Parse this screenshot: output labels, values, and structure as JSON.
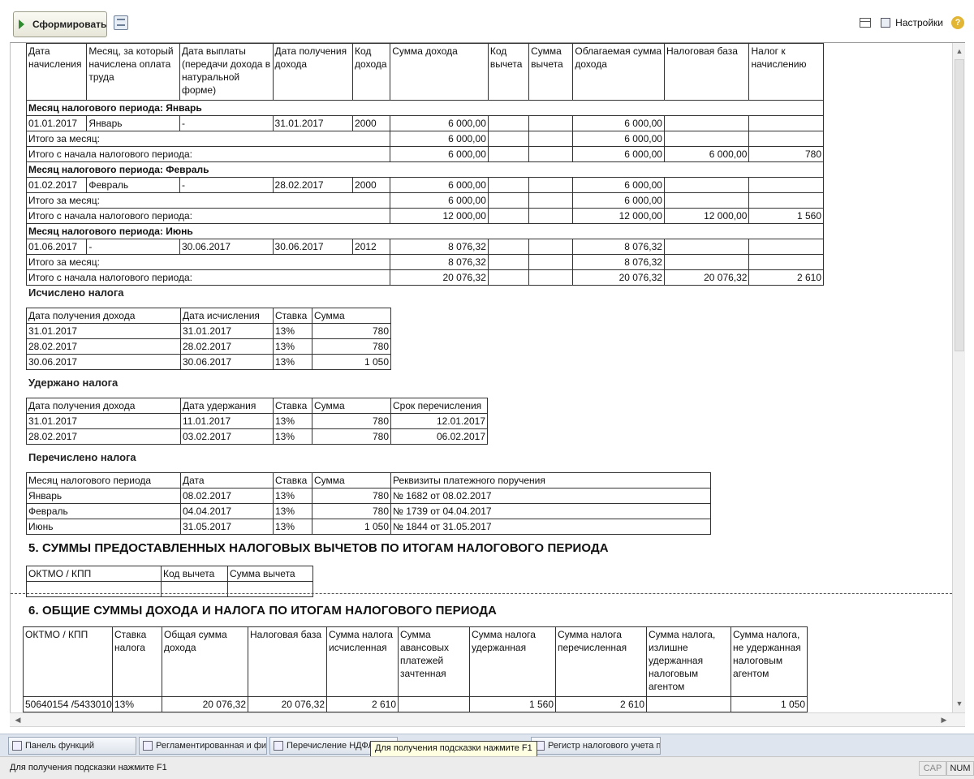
{
  "toolbar": {
    "form_button": "Сформировать",
    "settings_label": "Настройки",
    "help": "?"
  },
  "table1": {
    "headers": [
      "Дата начисления",
      "Месяц, за который начислена оплата труда",
      "Дата выплаты (передачи дохода в натуральной форме)",
      "Дата получения дохода",
      "Код дохода",
      "Сумма дохода",
      "Код вычета",
      "Сумма вычета",
      "Облагаемая сумма дохода",
      "Налоговая база",
      "Налог к начислению"
    ],
    "groups": [
      {
        "title": "Месяц налогового периода: Январь",
        "row": [
          "01.01.2017",
          "Январь",
          "-",
          "31.01.2017",
          "2000",
          "6 000,00",
          "",
          "",
          "6 000,00",
          "",
          ""
        ],
        "month_total": {
          "label": "Итого за месяц:",
          "income": "6 000,00",
          "taxable": "6 000,00"
        },
        "ytd_total": {
          "label": "Итого с начала налогового периода:",
          "income": "6 000,00",
          "taxable": "6 000,00",
          "base": "6 000,00",
          "tax": "780"
        }
      },
      {
        "title": "Месяц налогового периода: Февраль",
        "row": [
          "01.02.2017",
          "Февраль",
          "-",
          "28.02.2017",
          "2000",
          "6 000,00",
          "",
          "",
          "6 000,00",
          "",
          ""
        ],
        "month_total": {
          "label": "Итого за месяц:",
          "income": "6 000,00",
          "taxable": "6 000,00"
        },
        "ytd_total": {
          "label": "Итого с начала налогового периода:",
          "income": "12 000,00",
          "taxable": "12 000,00",
          "base": "12 000,00",
          "tax": "1 560"
        }
      },
      {
        "title": "Месяц налогового периода: Июнь",
        "row": [
          "01.06.2017",
          "-",
          "30.06.2017",
          "30.06.2017",
          "2012",
          "8 076,32",
          "",
          "",
          "8 076,32",
          "",
          ""
        ],
        "month_total": {
          "label": "Итого за месяц:",
          "income": "8 076,32",
          "taxable": "8 076,32"
        },
        "ytd_total": {
          "label": "Итого с начала налогового периода:",
          "income": "20 076,32",
          "taxable": "20 076,32",
          "base": "20 076,32",
          "tax": "2 610"
        }
      }
    ]
  },
  "calc": {
    "title": "Исчислено налога",
    "headers": [
      "Дата получения дохода",
      "Дата исчисления",
      "Ставка",
      "Сумма"
    ],
    "rows": [
      [
        "31.01.2017",
        "31.01.2017",
        "13%",
        "780"
      ],
      [
        "28.02.2017",
        "28.02.2017",
        "13%",
        "780"
      ],
      [
        "30.06.2017",
        "30.06.2017",
        "13%",
        "1 050"
      ]
    ]
  },
  "withheld": {
    "title": "Удержано налога",
    "headers": [
      "Дата получения дохода",
      "Дата удержания",
      "Ставка",
      "Сумма",
      "Срок перечисления"
    ],
    "rows": [
      [
        "31.01.2017",
        "11.01.2017",
        "13%",
        "780",
        "12.01.2017"
      ],
      [
        "28.02.2017",
        "03.02.2017",
        "13%",
        "780",
        "06.02.2017"
      ]
    ]
  },
  "paid": {
    "title": "Перечислено налога",
    "headers": [
      "Месяц налогового периода",
      "Дата",
      "Ставка",
      "Сумма",
      "Реквизиты платежного поручения"
    ],
    "rows": [
      [
        "Январь",
        "08.02.2017",
        "13%",
        "780",
        "№ 1682 от 08.02.2017"
      ],
      [
        "Февраль",
        "04.04.2017",
        "13%",
        "780",
        "№ 1739 от 04.04.2017"
      ],
      [
        "Июнь",
        "31.05.2017",
        "13%",
        "1 050",
        "№ 1844 от 31.05.2017"
      ]
    ]
  },
  "section5": {
    "title": "5. СУММЫ ПРЕДОСТАВЛЕННЫХ НАЛОГОВЫХ ВЫЧЕТОВ ПО ИТОГАМ НАЛОГОВОГО ПЕРИОДА",
    "headers": [
      "ОКТМО / КПП",
      "Код вычета",
      "Сумма вычета"
    ]
  },
  "section6": {
    "title": "6. ОБЩИЕ СУММЫ ДОХОДА И НАЛОГА ПО ИТОГАМ НАЛОГОВОГО ПЕРИОДА",
    "headers": [
      "ОКТМО / КПП",
      "Ставка налога",
      "Общая сумма дохода",
      "Налоговая база",
      "Сумма налога исчисленная",
      "Сумма авансовых платежей зачтенная",
      "Сумма налога удержанная",
      "Сумма налога перечисленная",
      "Сумма налога, излишне удержанная налоговым агентом",
      "Сумма налога, не удержанная налоговым агентом"
    ],
    "row": [
      "50640154  /5433010",
      "13%",
      "20 076,32",
      "20 076,32",
      "2 610",
      "",
      "1 560",
      "2 610",
      "",
      "1 050"
    ]
  },
  "taskbar": {
    "items": [
      "Панель функций",
      "Регламентированная и фин...",
      "Перечисление НДФЛ в ...",
      "Регистр налогового учета п..."
    ],
    "tooltip": "Для получения подсказки нажмите F1"
  },
  "status": {
    "message": "Для получения подсказки нажмите F1",
    "cap": "CAP",
    "num": "NUM"
  }
}
